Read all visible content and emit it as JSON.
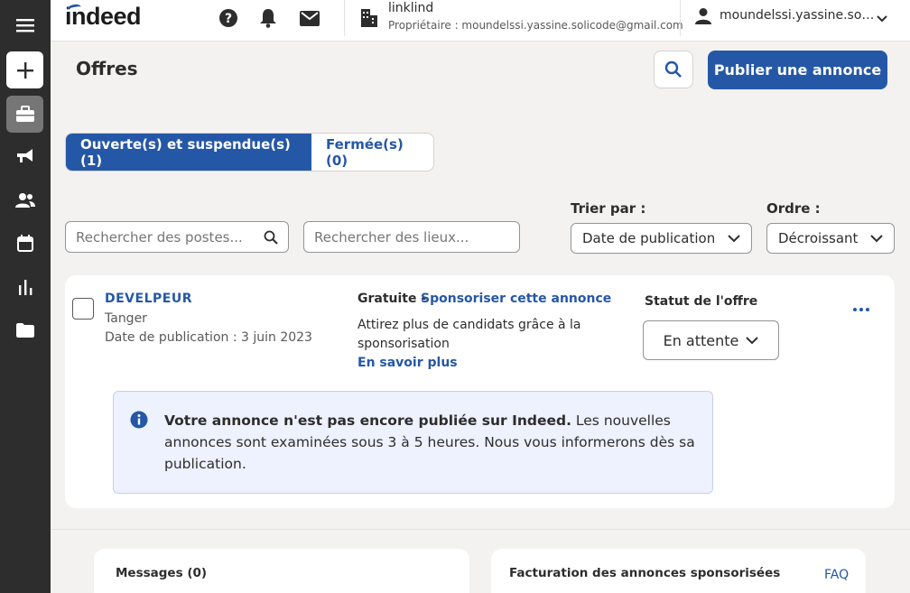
{
  "topbar": {
    "logo": "indeed",
    "company_name": "linklind",
    "company_owner": "Propriétaire : moundelssi.yassine.solicode@gmail.com",
    "user_name": "moundelssi.yassine.solicode@gmail.com"
  },
  "page": {
    "title": "Offres",
    "publish_label": "Publier une annonce"
  },
  "tabs": [
    {
      "label": "Ouverte(s) et suspendue(s) (1)",
      "active": true
    },
    {
      "label": "Fermée(s) (0)",
      "active": false
    }
  ],
  "filters": {
    "posts_placeholder": "Rechercher des postes...",
    "places_placeholder": "Rechercher des lieux...",
    "sort_label": "Trier par :",
    "sort_value": "Date de publication",
    "order_label": "Ordre :",
    "order_value": "Décroissant"
  },
  "job": {
    "title": "DEVELPEUR",
    "location": "Tanger",
    "date": "Date de publication : 3 juin 2023",
    "free_label": "Gratuite -",
    "sponsor_link": "Sponsoriser cette annonce",
    "sponsor_desc": "Attirez plus de candidats grâce à la sponsorisation",
    "learn_more": "En savoir plus",
    "status_label": "Statut de l'offre",
    "status_value": "En attente",
    "notice_bold": "Votre annonce n'est pas encore publiée sur Indeed.",
    "notice_text": " Les nouvelles annonces sont examinées sous 3 à 5 heures. Nous vous informerons dès sa publication."
  },
  "bottom": {
    "messages_title": "Messages (0)",
    "billing_title": "Facturation des annonces sponsorisées",
    "faq": "FAQ"
  },
  "colors": {
    "brand_blue": "#2557a7",
    "rail_bg": "#2d2d2d",
    "page_bg": "#f3f2f1",
    "notice_bg": "#eef1fe"
  }
}
